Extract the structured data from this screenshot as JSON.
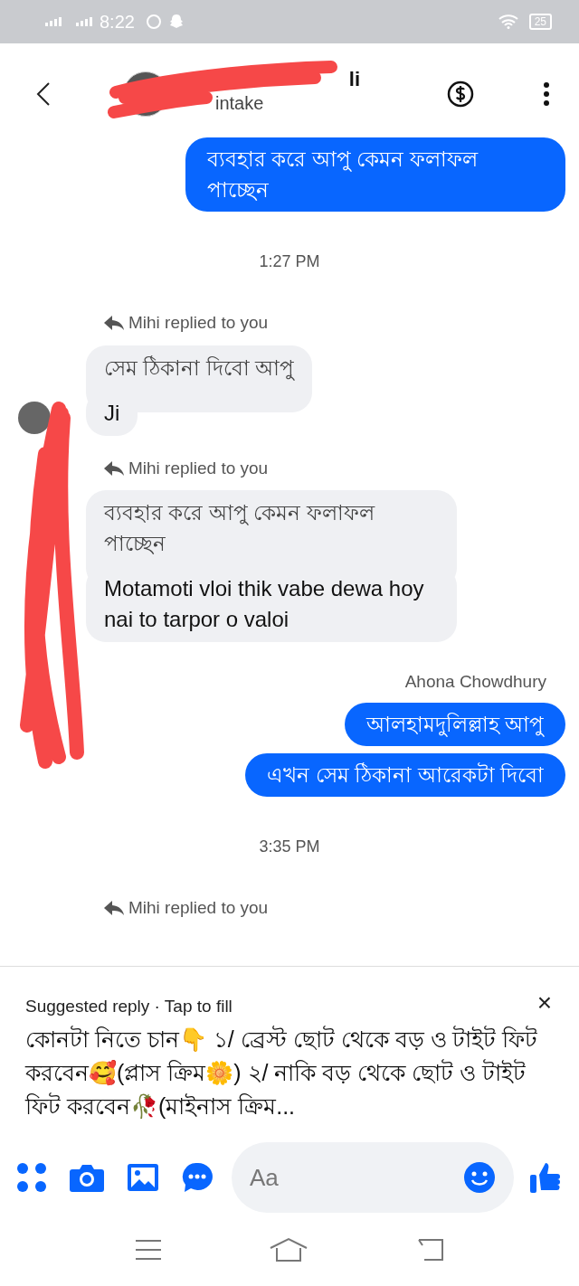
{
  "status_bar": {
    "time": "8:22",
    "battery": "25"
  },
  "header": {
    "name": "li",
    "subtitle": "intake"
  },
  "messages": [
    {
      "kind": "outgoing",
      "text": "ব্যবহার করে আপু কেমন ফলাফল পাচ্ছেন"
    },
    {
      "kind": "time",
      "text": "1:27 PM"
    },
    {
      "kind": "reply_note",
      "text": "Mihi replied to you"
    },
    {
      "kind": "incoming",
      "quote": "সেম ঠিকানা দিবো আপু",
      "text": "Ji",
      "avatar": true
    },
    {
      "kind": "reply_note",
      "text": "Mihi replied to you"
    },
    {
      "kind": "incoming",
      "quote": "ব্যবহার করে আপু কেমন ফলাফল পাচ্ছেন",
      "text": "Motamoti vloi thik vabe dewa hoy nai to tarpor o valoi",
      "avatar": false
    },
    {
      "kind": "sender",
      "text": "Ahona Chowdhury"
    },
    {
      "kind": "outgoing",
      "text": "আলহামদুলিল্লাহ আপু"
    },
    {
      "kind": "outgoing",
      "text": "এখন সেম ঠিকানা আরেকটা দিবো"
    },
    {
      "kind": "time",
      "text": "3:35 PM"
    },
    {
      "kind": "reply_note",
      "text": "Mihi replied to you"
    }
  ],
  "suggestion": {
    "label": "Suggested reply · Tap to fill",
    "close": "×",
    "text": "কোনটা নিতে চান👇 ১/ ব্রেস্ট ছোট থেকে বড় ও টাইট ফিট করবেন🥰(প্লাস ক্রিম🌼) ২/ নাকি বড় থেকে ছোট ও টাইট ফিট করবেন🥀(মাইনাস ক্রিম..."
  },
  "composer": {
    "placeholder": "Aa"
  }
}
